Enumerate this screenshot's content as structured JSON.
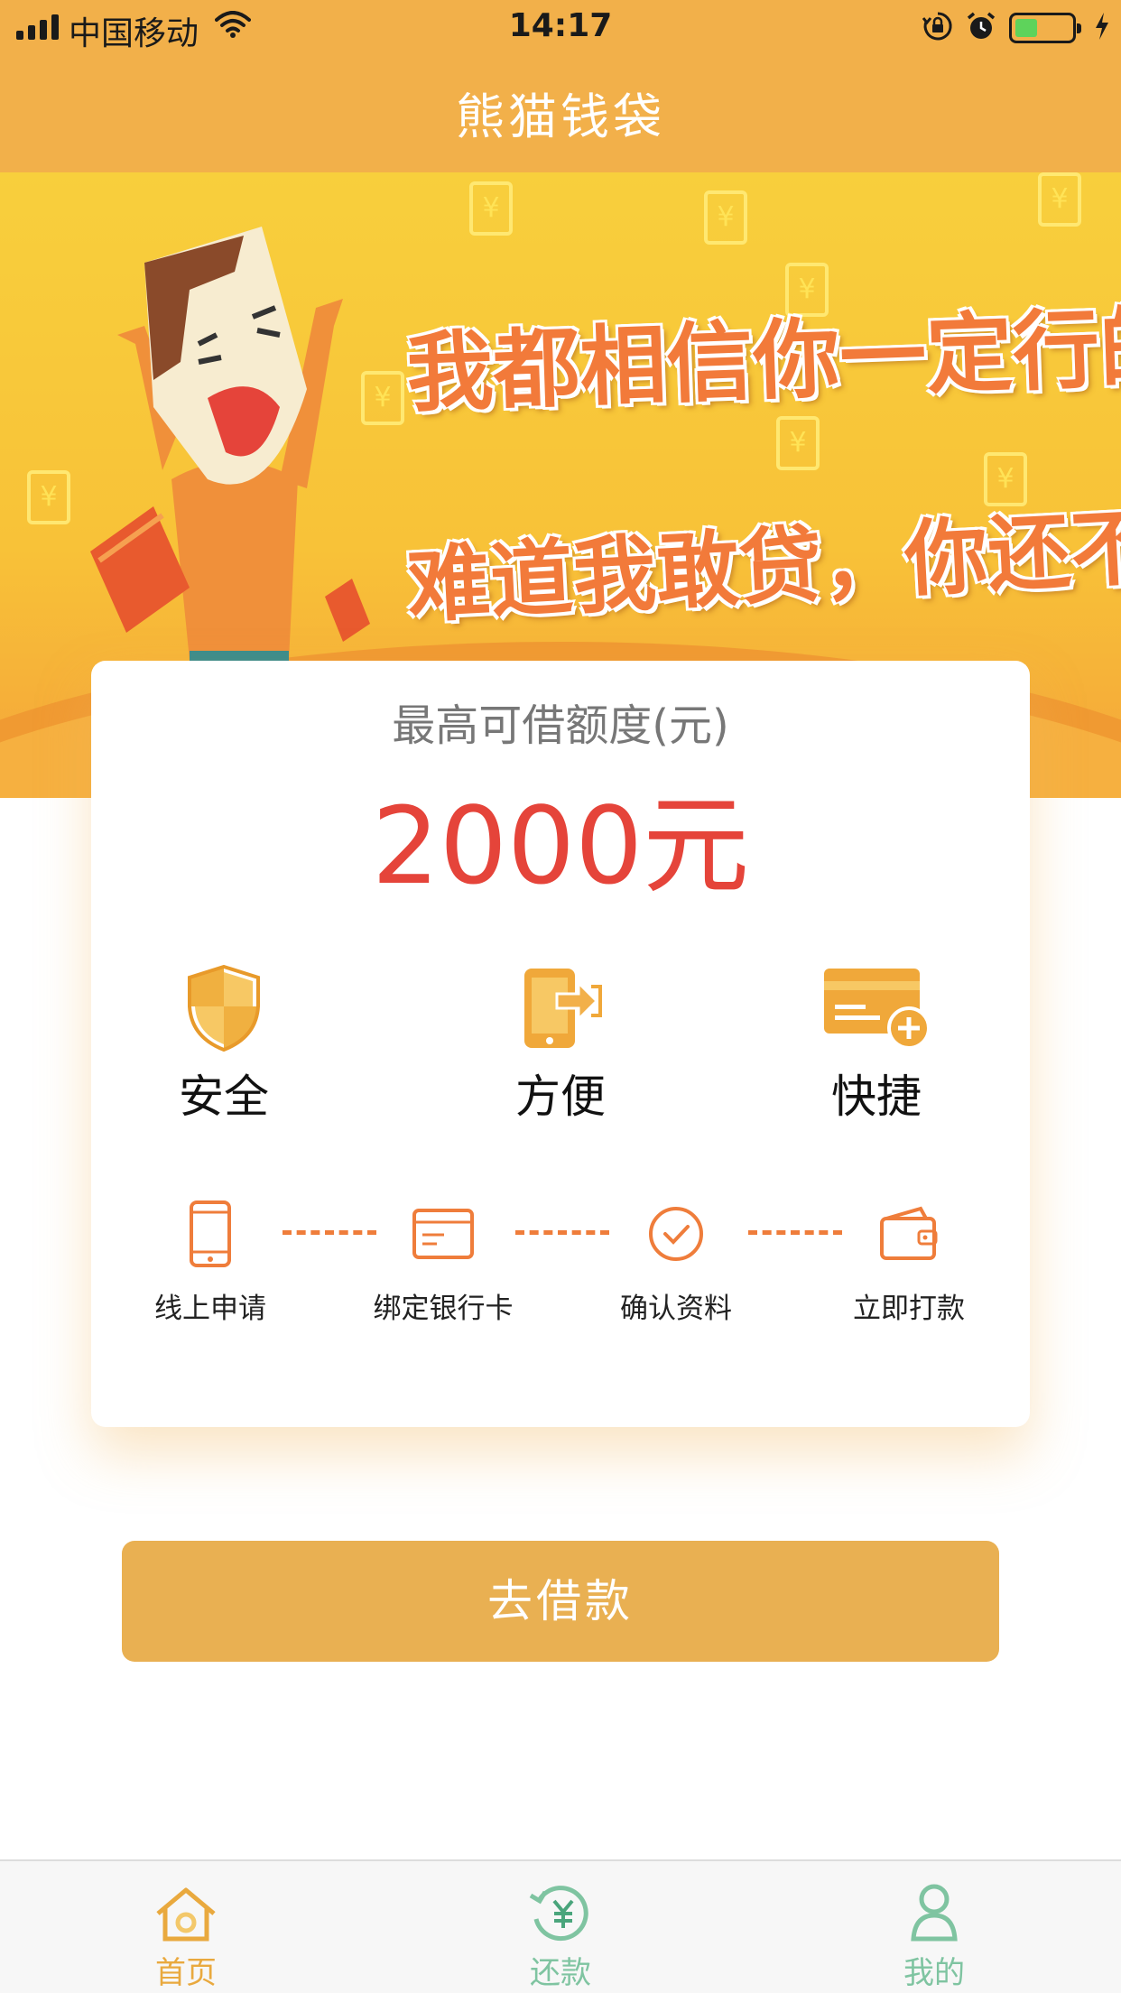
{
  "status_bar": {
    "carrier": "中国移动",
    "time": "14:17"
  },
  "nav": {
    "title": "熊猫钱袋"
  },
  "banner": {
    "line1": "我都相信你一定行的",
    "line2": "难道我敢贷，你还不敢借？"
  },
  "card": {
    "title": "最高可借额度(元)",
    "amount": "2000元",
    "features": [
      {
        "label": "安全",
        "icon": "shield-icon"
      },
      {
        "label": "方便",
        "icon": "phone-transfer-icon"
      },
      {
        "label": "快捷",
        "icon": "card-plus-icon"
      }
    ],
    "steps": [
      {
        "label": "线上申请",
        "icon": "mobile-phone-icon"
      },
      {
        "label": "绑定银行卡",
        "icon": "bank-card-icon"
      },
      {
        "label": "确认资料",
        "icon": "check-circle-icon"
      },
      {
        "label": "立即打款",
        "icon": "wallet-icon"
      }
    ]
  },
  "cta": {
    "label": "去借款"
  },
  "tabbar": {
    "items": [
      {
        "label": "首页",
        "icon": "home-icon",
        "active": true
      },
      {
        "label": "还款",
        "icon": "repay-yuan-icon",
        "active": false
      },
      {
        "label": "我的",
        "icon": "user-icon",
        "active": false
      }
    ]
  },
  "colors": {
    "brand": "#f2b04a",
    "amount": "#e5443a",
    "button": "#e9b052",
    "tab_active": "#e9a93e",
    "tab_inactive": "#7fc4a1",
    "step_accent": "#ef7d3b"
  }
}
